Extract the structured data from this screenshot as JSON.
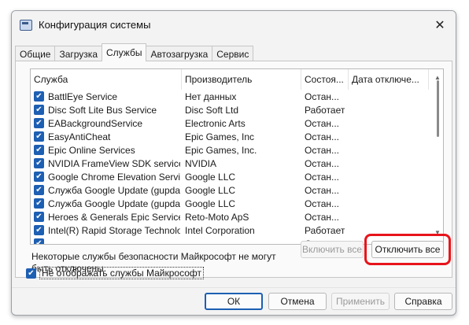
{
  "window": {
    "title": "Конфигурация системы",
    "close_glyph": "✕"
  },
  "tabs": [
    {
      "label": "Общие",
      "active": false
    },
    {
      "label": "Загрузка",
      "active": false
    },
    {
      "label": "Службы",
      "active": true
    },
    {
      "label": "Автозагрузка",
      "active": false
    },
    {
      "label": "Сервис",
      "active": false
    }
  ],
  "services": {
    "columns": [
      "Служба",
      "Производитель",
      "Состоя...",
      "Дата отключе..."
    ],
    "rows": [
      {
        "checked": true,
        "name": "BattlEye Service",
        "maker": "Нет данных",
        "status": "Остан..."
      },
      {
        "checked": true,
        "name": "Disc Soft Lite Bus Service",
        "maker": "Disc Soft Ltd",
        "status": "Работает"
      },
      {
        "checked": true,
        "name": "EABackgroundService",
        "maker": "Electronic Arts",
        "status": "Остан..."
      },
      {
        "checked": true,
        "name": "EasyAntiCheat",
        "maker": "Epic Games, Inc",
        "status": "Остан..."
      },
      {
        "checked": true,
        "name": "Epic Online Services",
        "maker": "Epic Games, Inc.",
        "status": "Остан..."
      },
      {
        "checked": true,
        "name": "NVIDIA FrameView SDK service",
        "maker": "NVIDIA",
        "status": "Остан..."
      },
      {
        "checked": true,
        "name": "Google Chrome Elevation Servic...",
        "maker": "Google LLC",
        "status": "Остан..."
      },
      {
        "checked": true,
        "name": "Служба Google Update (gupdate)",
        "maker": "Google LLC",
        "status": "Остан..."
      },
      {
        "checked": true,
        "name": "Служба Google Update (gupdatem)",
        "maker": "Google LLC",
        "status": "Остан..."
      },
      {
        "checked": true,
        "name": "Heroes & Generals Epic Service",
        "maker": "Reto-Moto ApS",
        "status": "Остан..."
      },
      {
        "checked": true,
        "name": "Intel(R) Rapid Storage Technology",
        "maker": "Intel Corporation",
        "status": "Работает"
      },
      {
        "checked": true,
        "name": "",
        "maker": "",
        "status": "Остан..."
      }
    ]
  },
  "note": "Некоторые службы безопасности Майкрософт не могут быть отключены.",
  "buttons": {
    "enable_all": "Включить все",
    "disable_all": "Отключить все",
    "ok": "ОК",
    "cancel": "Отмена",
    "apply": "Применить",
    "help": "Справка"
  },
  "hide_ms": {
    "checked": true,
    "label": "Не отображать службы Майкрософт"
  },
  "colors": {
    "accent": "#1d5fb3",
    "highlight": "#e8141b"
  }
}
